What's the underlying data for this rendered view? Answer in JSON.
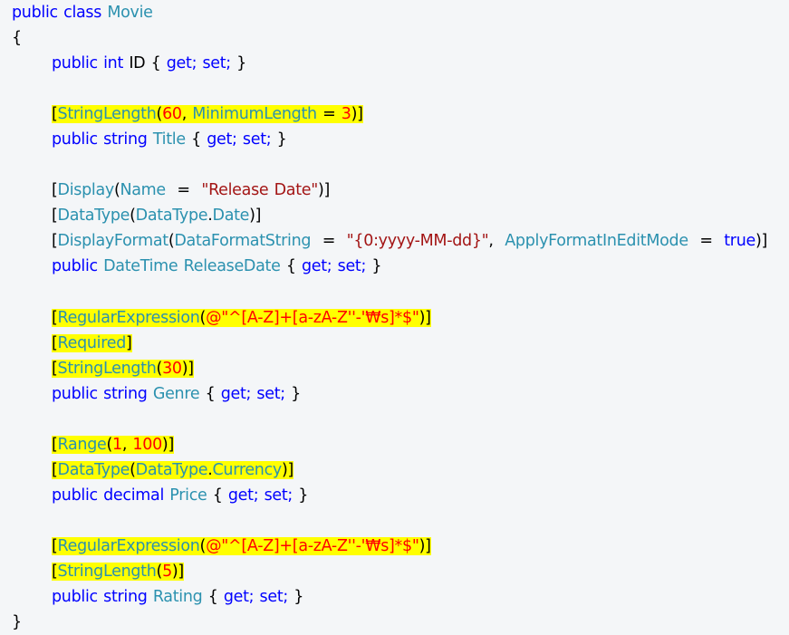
{
  "code_lines": [
    {
      "indent": 0,
      "highlight": false,
      "tokens": [
        {
          "t": "public",
          "c": "kw"
        },
        {
          "t": " "
        },
        {
          "t": "class",
          "c": "kw"
        },
        {
          "t": " "
        },
        {
          "t": "Movie",
          "c": "typ"
        }
      ]
    },
    {
      "indent": 0,
      "highlight": false,
      "tokens": [
        {
          "t": "{",
          "c": "plain"
        }
      ]
    },
    {
      "indent": 1,
      "highlight": false,
      "tokens": [
        {
          "t": "public",
          "c": "kw"
        },
        {
          "t": " "
        },
        {
          "t": "int",
          "c": "kw"
        },
        {
          "t": " "
        },
        {
          "t": "ID",
          "c": "plain"
        },
        {
          "t": " "
        },
        {
          "t": "{",
          "c": "plain"
        },
        {
          "t": " "
        },
        {
          "t": "get;",
          "c": "kw"
        },
        {
          "t": " "
        },
        {
          "t": "set;",
          "c": "kw"
        },
        {
          "t": " "
        },
        {
          "t": "}",
          "c": "plain"
        }
      ]
    },
    {
      "indent": 0,
      "highlight": false,
      "tokens": []
    },
    {
      "indent": 1,
      "highlight": true,
      "tokens": [
        {
          "t": "[",
          "c": "plain"
        },
        {
          "t": "StringLength",
          "c": "typ"
        },
        {
          "t": "(",
          "c": "plain"
        },
        {
          "t": "60",
          "c": "num"
        },
        {
          "t": ", ",
          "c": "plain"
        },
        {
          "t": "MinimumLength",
          "c": "typ"
        },
        {
          "t": " = ",
          "c": "plain"
        },
        {
          "t": "3",
          "c": "num"
        },
        {
          "t": ")]",
          "c": "plain"
        }
      ]
    },
    {
      "indent": 1,
      "highlight": false,
      "tokens": [
        {
          "t": "public",
          "c": "kw"
        },
        {
          "t": " "
        },
        {
          "t": "string",
          "c": "kw"
        },
        {
          "t": " "
        },
        {
          "t": "Title",
          "c": "typ"
        },
        {
          "t": " "
        },
        {
          "t": "{",
          "c": "plain"
        },
        {
          "t": " "
        },
        {
          "t": "get;",
          "c": "kw"
        },
        {
          "t": " "
        },
        {
          "t": "set;",
          "c": "kw"
        },
        {
          "t": " "
        },
        {
          "t": "}",
          "c": "plain"
        }
      ]
    },
    {
      "indent": 0,
      "highlight": false,
      "tokens": []
    },
    {
      "indent": 1,
      "highlight": false,
      "tokens": [
        {
          "t": "[",
          "c": "plain"
        },
        {
          "t": "Display",
          "c": "typ"
        },
        {
          "t": "(",
          "c": "plain"
        },
        {
          "t": "Name",
          "c": "typ"
        },
        {
          "t": "  =  ",
          "c": "plain"
        },
        {
          "t": "\"Release Date\"",
          "c": "str"
        },
        {
          "t": ")]",
          "c": "plain"
        }
      ]
    },
    {
      "indent": 1,
      "highlight": false,
      "tokens": [
        {
          "t": "[",
          "c": "plain"
        },
        {
          "t": "DataType",
          "c": "typ"
        },
        {
          "t": "(",
          "c": "plain"
        },
        {
          "t": "DataType",
          "c": "typ"
        },
        {
          "t": ".",
          "c": "plain"
        },
        {
          "t": "Date",
          "c": "typ"
        },
        {
          "t": ")]",
          "c": "plain"
        }
      ]
    },
    {
      "indent": 1,
      "highlight": false,
      "tokens": [
        {
          "t": "[",
          "c": "plain"
        },
        {
          "t": "DisplayFormat",
          "c": "typ"
        },
        {
          "t": "(",
          "c": "plain"
        },
        {
          "t": "DataFormatString",
          "c": "typ"
        },
        {
          "t": "  =  ",
          "c": "plain"
        },
        {
          "t": "\"{0:yyyy-MM-dd}\"",
          "c": "str"
        },
        {
          "t": ",  ",
          "c": "plain"
        },
        {
          "t": "ApplyFormatInEditMode",
          "c": "typ"
        },
        {
          "t": "  =  ",
          "c": "plain"
        },
        {
          "t": "true",
          "c": "kw"
        },
        {
          "t": ")]",
          "c": "plain"
        }
      ]
    },
    {
      "indent": 1,
      "highlight": false,
      "tokens": [
        {
          "t": "public",
          "c": "kw"
        },
        {
          "t": " "
        },
        {
          "t": "DateTime",
          "c": "typ"
        },
        {
          "t": " "
        },
        {
          "t": "ReleaseDate",
          "c": "typ"
        },
        {
          "t": " "
        },
        {
          "t": "{",
          "c": "plain"
        },
        {
          "t": " "
        },
        {
          "t": "get;",
          "c": "kw"
        },
        {
          "t": " "
        },
        {
          "t": "set;",
          "c": "kw"
        },
        {
          "t": " "
        },
        {
          "t": "}",
          "c": "plain"
        }
      ]
    },
    {
      "indent": 0,
      "highlight": false,
      "tokens": []
    },
    {
      "indent": 1,
      "highlight": true,
      "tokens": [
        {
          "t": "[",
          "c": "plain"
        },
        {
          "t": "RegularExpression",
          "c": "typ"
        },
        {
          "t": "(",
          "c": "plain"
        },
        {
          "t": "@\"^[A-Z]+[a-zA-Z''-'₩s]*$\"",
          "c": "str"
        },
        {
          "t": ")]",
          "c": "plain"
        }
      ]
    },
    {
      "indent": 1,
      "highlight": true,
      "tokens": [
        {
          "t": "[",
          "c": "plain"
        },
        {
          "t": "Required",
          "c": "typ"
        },
        {
          "t": "]",
          "c": "plain"
        }
      ]
    },
    {
      "indent": 1,
      "highlight": true,
      "tokens": [
        {
          "t": "[",
          "c": "plain"
        },
        {
          "t": "StringLength",
          "c": "typ"
        },
        {
          "t": "(",
          "c": "plain"
        },
        {
          "t": "30",
          "c": "num"
        },
        {
          "t": ")]",
          "c": "plain"
        }
      ]
    },
    {
      "indent": 1,
      "highlight": false,
      "tokens": [
        {
          "t": "public",
          "c": "kw"
        },
        {
          "t": " "
        },
        {
          "t": "string",
          "c": "kw"
        },
        {
          "t": " "
        },
        {
          "t": "Genre",
          "c": "typ"
        },
        {
          "t": " "
        },
        {
          "t": "{",
          "c": "plain"
        },
        {
          "t": " "
        },
        {
          "t": "get;",
          "c": "kw"
        },
        {
          "t": " "
        },
        {
          "t": "set;",
          "c": "kw"
        },
        {
          "t": " "
        },
        {
          "t": "}",
          "c": "plain"
        }
      ]
    },
    {
      "indent": 0,
      "highlight": false,
      "tokens": []
    },
    {
      "indent": 1,
      "highlight": true,
      "tokens": [
        {
          "t": "[",
          "c": "plain"
        },
        {
          "t": "Range",
          "c": "typ"
        },
        {
          "t": "(",
          "c": "plain"
        },
        {
          "t": "1",
          "c": "num"
        },
        {
          "t": ", ",
          "c": "plain"
        },
        {
          "t": "100",
          "c": "num"
        },
        {
          "t": ")]",
          "c": "plain"
        }
      ]
    },
    {
      "indent": 1,
      "highlight": true,
      "tokens": [
        {
          "t": "[",
          "c": "plain"
        },
        {
          "t": "DataType",
          "c": "typ"
        },
        {
          "t": "(",
          "c": "plain"
        },
        {
          "t": "DataType",
          "c": "typ"
        },
        {
          "t": ".",
          "c": "plain"
        },
        {
          "t": "Currency",
          "c": "typ"
        },
        {
          "t": ")]",
          "c": "plain"
        }
      ]
    },
    {
      "indent": 1,
      "highlight": false,
      "tokens": [
        {
          "t": "public",
          "c": "kw"
        },
        {
          "t": " "
        },
        {
          "t": "decimal",
          "c": "kw"
        },
        {
          "t": " "
        },
        {
          "t": "Price",
          "c": "typ"
        },
        {
          "t": " "
        },
        {
          "t": "{",
          "c": "plain"
        },
        {
          "t": " "
        },
        {
          "t": "get;",
          "c": "kw"
        },
        {
          "t": " "
        },
        {
          "t": "set;",
          "c": "kw"
        },
        {
          "t": " "
        },
        {
          "t": "}",
          "c": "plain"
        }
      ]
    },
    {
      "indent": 0,
      "highlight": false,
      "tokens": []
    },
    {
      "indent": 1,
      "highlight": true,
      "tokens": [
        {
          "t": "[",
          "c": "plain"
        },
        {
          "t": "RegularExpression",
          "c": "typ"
        },
        {
          "t": "(",
          "c": "plain"
        },
        {
          "t": "@\"^[A-Z]+[a-zA-Z''-'₩s]*$\"",
          "c": "str"
        },
        {
          "t": ")]",
          "c": "plain"
        }
      ]
    },
    {
      "indent": 1,
      "highlight": true,
      "tokens": [
        {
          "t": "[",
          "c": "plain"
        },
        {
          "t": "StringLength",
          "c": "typ"
        },
        {
          "t": "(",
          "c": "plain"
        },
        {
          "t": "5",
          "c": "num"
        },
        {
          "t": ")]",
          "c": "plain"
        }
      ]
    },
    {
      "indent": 1,
      "highlight": false,
      "tokens": [
        {
          "t": "public",
          "c": "kw"
        },
        {
          "t": " "
        },
        {
          "t": "string",
          "c": "kw"
        },
        {
          "t": " "
        },
        {
          "t": "Rating",
          "c": "typ"
        },
        {
          "t": " "
        },
        {
          "t": "{",
          "c": "plain"
        },
        {
          "t": " "
        },
        {
          "t": "get;",
          "c": "kw"
        },
        {
          "t": " "
        },
        {
          "t": "set;",
          "c": "kw"
        },
        {
          "t": " "
        },
        {
          "t": "}",
          "c": "plain"
        }
      ]
    },
    {
      "indent": 0,
      "highlight": false,
      "tokens": [
        {
          "t": "}",
          "c": "plain"
        }
      ]
    }
  ],
  "colors": {
    "background": "#f4f6f8",
    "keyword": "#0000ff",
    "type": "#2b91af",
    "string": "#a31515",
    "highlight": "#ffff00",
    "highlight_literal": "#ff0000"
  }
}
